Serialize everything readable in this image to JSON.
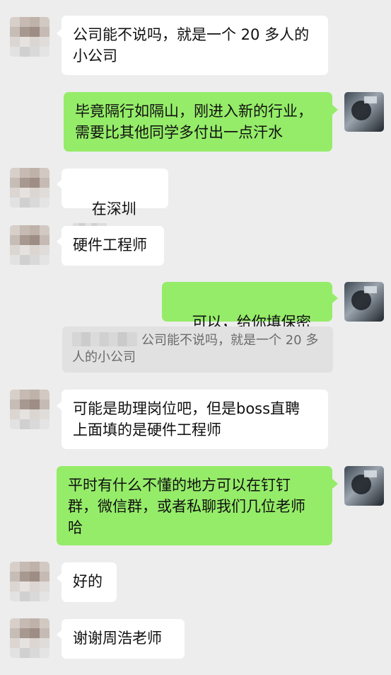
{
  "messages": [
    {
      "side": "left",
      "text": "公司能不说吗，就是一个 20 多人的\n小公司"
    },
    {
      "side": "right",
      "text": "毕竟隔行如隔山，刚进入新的行业，\n需要比其他同学多付出一点汗水"
    },
    {
      "side": "left",
      "text_prefix": "在深圳"
    },
    {
      "side": "left",
      "text": "硬件工程师"
    },
    {
      "side": "right",
      "text": "可以，给你填保密",
      "emoji": "grin-emoji"
    },
    {
      "side": "left",
      "text": "可能是助理岗位吧，但是boss直聘\n上面填的是硬件工程师"
    },
    {
      "side": "right",
      "text": "平时有什么不懂的地方可以在钉钉\n群，微信群，或者私聊我们几位老师\n哈"
    },
    {
      "side": "left",
      "text": "好的"
    },
    {
      "side": "left",
      "text": "谢谢周浩老师"
    }
  ],
  "quote": {
    "text_line1": "公司能不说吗，就是一个 20 多",
    "text_line2": "人的小公司"
  },
  "colors": {
    "background": "#ededed",
    "left_bubble": "#ffffff",
    "right_bubble": "#95ec69",
    "quote_bg": "#e1e1e1",
    "quote_text": "#6b6b6b"
  }
}
